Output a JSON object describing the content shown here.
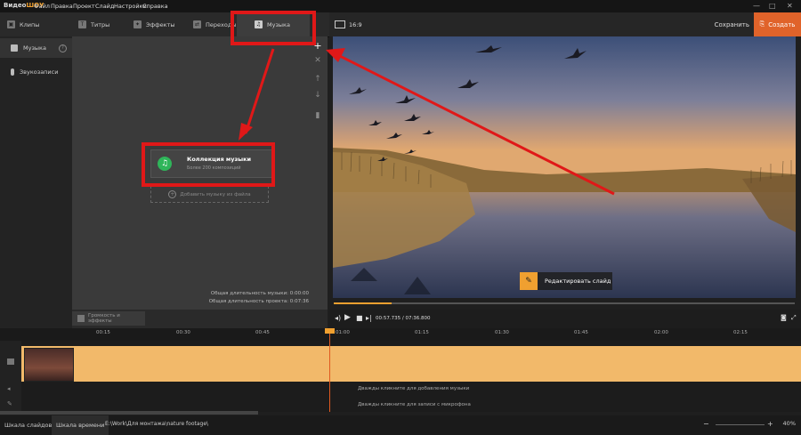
{
  "app": {
    "logo_a": "Видео",
    "logo_b": "ШОУ"
  },
  "menu": [
    "Файл",
    "Правка",
    "Проект",
    "Слайд",
    "Настройки",
    "Справка"
  ],
  "tabs": [
    {
      "label": "Клипы",
      "icon": "clips-icon"
    },
    {
      "label": "Титры",
      "icon": "titles-icon"
    },
    {
      "label": "Эффекты",
      "icon": "effects-icon"
    },
    {
      "label": "Переходы",
      "icon": "transitions-icon"
    },
    {
      "label": "Музыка",
      "icon": "music-icon"
    }
  ],
  "preview_header": {
    "ratio": "16:9",
    "save": "Сохранить",
    "create": "Создать"
  },
  "sidebar": [
    {
      "label": "Музыка"
    },
    {
      "label": "Звукозаписи"
    }
  ],
  "music_panel": {
    "card_title": "Коллекция музыки",
    "card_sub": "Более 200 композиций",
    "add_file": "Добавить музыку из файла",
    "dur_music": "Общая длительность музыки: 0:00:00",
    "dur_project": "Общая длительность проекта: 0:07:36",
    "effects_btn": "Громкость и эффекты"
  },
  "preview": {
    "edit_slide": "Редактировать слайд"
  },
  "playback": {
    "time": "00:57.735 / 07:36.800",
    "progress": 0.126
  },
  "ruler_labels": [
    "00:15",
    "00:30",
    "00:45",
    "01:00",
    "01:15",
    "01:30",
    "01:45",
    "02:00",
    "02:15"
  ],
  "timeline": {
    "hint_music": "Дважды кликните для добавления музыки",
    "hint_mic": "Дважды кликните для записи с микрофона"
  },
  "statusbar": {
    "tab_slides": "Шкала слайдов",
    "tab_timeline": "Шкала времени",
    "path": "E:\\Work\\Для монтажа\\nature footage\\",
    "zoom": "40%"
  },
  "colors": {
    "accent": "#f0a030",
    "create": "#e0632a",
    "arrow": "#e01818",
    "track": "#f2b96a"
  }
}
